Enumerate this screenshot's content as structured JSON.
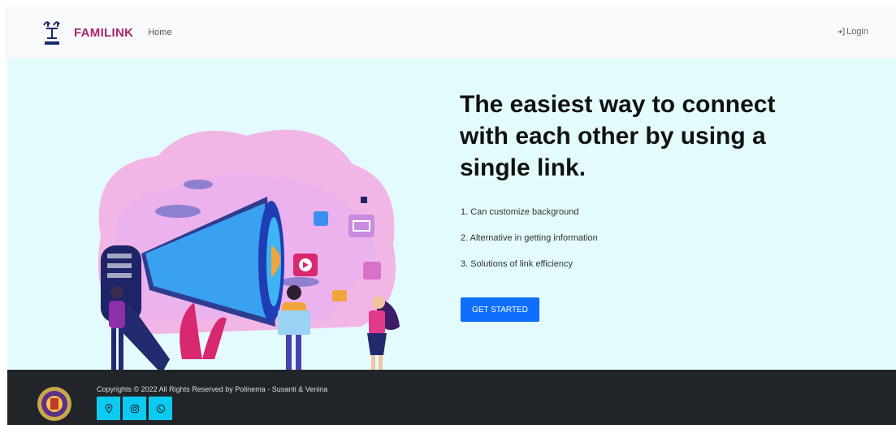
{
  "navbar": {
    "brand_name": "FAMILINK",
    "logo_icon": "familink-logo",
    "home_label": "Home",
    "login_label": "Login",
    "login_icon": "login-arrow-icon"
  },
  "hero": {
    "title": "The easiest way to connect with each other by using a single link.",
    "features": [
      "1. Can customize background",
      "2. Alternative in getting information",
      "3. Solutions of link efficiency"
    ],
    "cta_label": "GET STARTED",
    "illustration_icon": "megaphone-marketing-illustration"
  },
  "footer": {
    "copyright": "Copyrights © 2022 All Rights Reserved by Polinema - Susanti & Venina",
    "seal_icon": "polinema-seal",
    "social_icons": [
      "location-icon",
      "instagram-icon",
      "whatsapp-icon"
    ]
  },
  "colors": {
    "brand": "#a72572",
    "hero_bg": "#e3fbfc",
    "cta_bg": "#0d6efd",
    "footer_bg": "#212529",
    "social_bg": "#0dcaf0"
  }
}
